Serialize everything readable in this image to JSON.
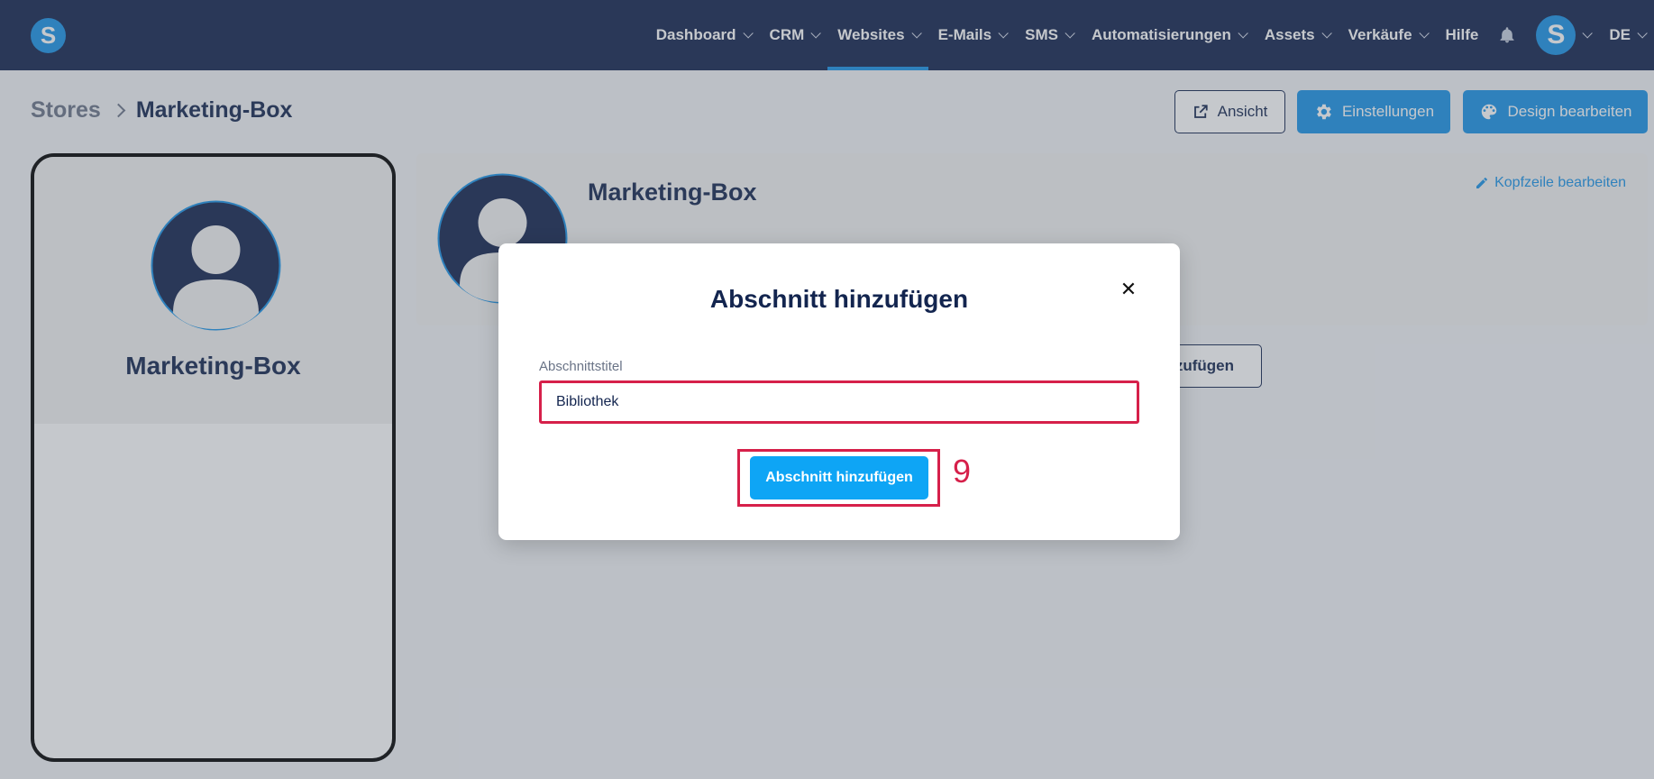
{
  "app": {
    "logo_letter": "S"
  },
  "nav": {
    "items": [
      {
        "label": "Dashboard",
        "has_chevron": true
      },
      {
        "label": "CRM",
        "has_chevron": true
      },
      {
        "label": "Websites",
        "has_chevron": true,
        "active": true
      },
      {
        "label": "E-Mails",
        "has_chevron": true
      },
      {
        "label": "SMS",
        "has_chevron": true
      },
      {
        "label": "Automatisierungen",
        "has_chevron": true
      },
      {
        "label": "Assets",
        "has_chevron": true
      },
      {
        "label": "Verkäufe",
        "has_chevron": true
      },
      {
        "label": "Hilfe",
        "has_chevron": false
      }
    ],
    "bell_icon": "bell-icon",
    "user_avatar_letter": "S",
    "language": "DE"
  },
  "breadcrumb": {
    "parent": "Stores",
    "current": "Marketing-Box"
  },
  "toolbar": {
    "view_label": "Ansicht",
    "settings_label": "Einstellungen",
    "design_label": "Design bearbeiten"
  },
  "preview": {
    "title": "Marketing-Box"
  },
  "store_header": {
    "title": "Marketing-Box",
    "edit_header_label": "Kopfzeile bearbeiten",
    "add_section_partial_label": "nzufügen"
  },
  "modal": {
    "title": "Abschnitt hinzufügen",
    "close_glyph": "✕",
    "field_label": "Abschnittstitel",
    "field_value": "Bibliothek",
    "submit_label": "Abschnitt hinzufügen",
    "step_number": "9"
  },
  "colors": {
    "nav_bg": "#12224d",
    "accent_blue": "#1992e6",
    "submit_blue": "#0ea5f5",
    "highlight_red": "#d6204a",
    "text_navy": "#13254f"
  }
}
